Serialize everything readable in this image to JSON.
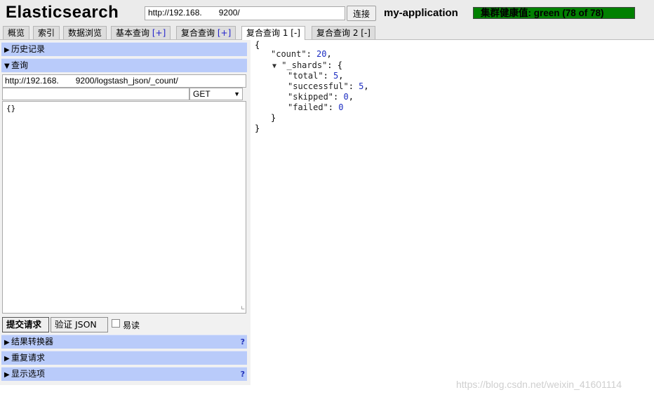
{
  "header": {
    "title": "Elasticsearch",
    "url": "http://192.168.  9200/",
    "connect_label": "连接",
    "cluster_name": "my-application",
    "health": "集群健康值: green (78 of 78)"
  },
  "tabs": [
    {
      "label": "概览"
    },
    {
      "label": "索引"
    },
    {
      "label": "数据浏览"
    },
    {
      "label": "基本查询",
      "control": "[+]"
    },
    {
      "label": "复合查询",
      "control": "[+]"
    },
    {
      "label": "复合查询 1",
      "control": "[-]"
    },
    {
      "label": "复合查询 2",
      "control": "[-]"
    }
  ],
  "sections": {
    "history": "历史记录",
    "query": "查询",
    "transformer": "结果转换器",
    "repeat": "重复请求",
    "display": "显示选项",
    "help": "?"
  },
  "query": {
    "url": "http://192.168.  9200/logstash_json/_count/",
    "path": "",
    "method": "GET",
    "body": "{}"
  },
  "buttons": {
    "submit": "提交请求",
    "validate": "验证 JSON",
    "readonly_label": "易读"
  },
  "result": {
    "open_brace": "{",
    "count_key": "\"count\"",
    "count_value": "20",
    "shards_key": "\"_shards\"",
    "total_key": "\"total\"",
    "total_value": "5",
    "successful_key": "\"successful\"",
    "successful_value": "5",
    "skipped_key": "\"skipped\"",
    "skipped_value": "0",
    "failed_key": "\"failed\"",
    "failed_value": "0",
    "inner_close": "}",
    "close_brace": "}"
  },
  "watermark": "https://blog.csdn.net/weixin_41601114",
  "colors": {
    "health": "#008000",
    "section": "#b9cbfa",
    "json_value": "#1b2cc1"
  }
}
